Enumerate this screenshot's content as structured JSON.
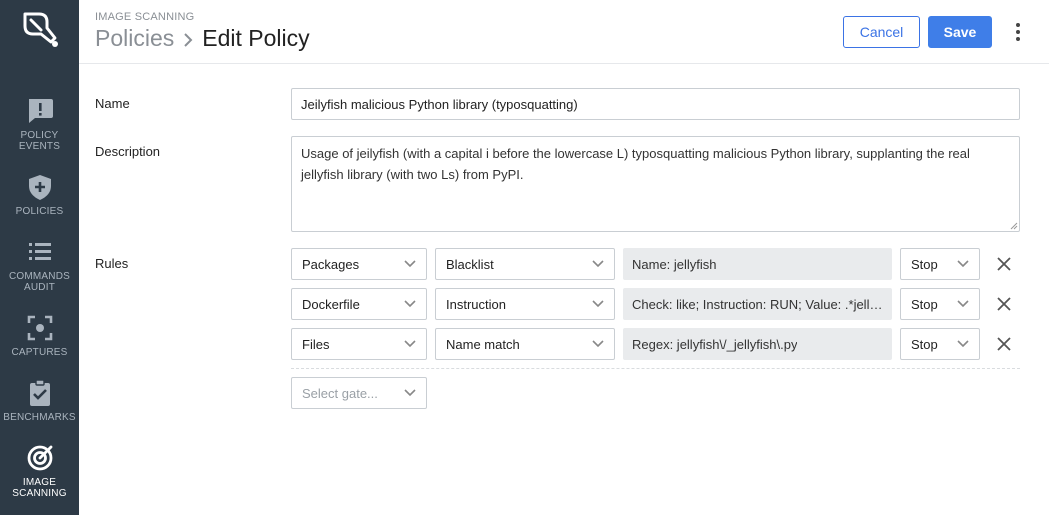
{
  "sidebar": {
    "items": [
      {
        "label": "POLICY\nEVENTS",
        "icon": "alert-bubble-icon",
        "active": false
      },
      {
        "label": "POLICIES",
        "icon": "shield-icon",
        "active": false
      },
      {
        "label": "COMMANDS\nAUDIT",
        "icon": "list-icon",
        "active": false
      },
      {
        "label": "CAPTURES",
        "icon": "capture-icon",
        "active": false
      },
      {
        "label": "BENCHMARKS",
        "icon": "clipboard-check-icon",
        "active": false
      },
      {
        "label": "IMAGE\nSCANNING",
        "icon": "scan-icon",
        "active": true
      }
    ]
  },
  "header": {
    "section": "IMAGE SCANNING",
    "breadcrumb_parent": "Policies",
    "breadcrumb_current": "Edit Policy",
    "cancel_label": "Cancel",
    "save_label": "Save"
  },
  "form": {
    "name_label": "Name",
    "name_value": "Jeilyfish malicious Python library (typosquatting)",
    "description_label": "Description",
    "description_value": "Usage of jeilyfish (with a capital i before the lowercase L) typosquatting malicious Python library, supplanting the real jellyfish library (with two Ls) from PyPI.",
    "rules_label": "Rules",
    "rules": [
      {
        "gate": "Packages",
        "trigger": "Blacklist",
        "params": "Name: jellyfish",
        "action": "Stop"
      },
      {
        "gate": "Dockerfile",
        "trigger": "Instruction",
        "params": "Check: like; Instruction: RUN; Value: .*jellyfish.*",
        "action": "Stop"
      },
      {
        "gate": "Files",
        "trigger": "Name match",
        "params": "Regex: jellyfish\\/_jellyfish\\.py",
        "action": "Stop"
      }
    ],
    "select_gate_placeholder": "Select gate..."
  },
  "colors": {
    "sidebar_bg": "#2d3a46",
    "accent": "#3f7ee8"
  }
}
